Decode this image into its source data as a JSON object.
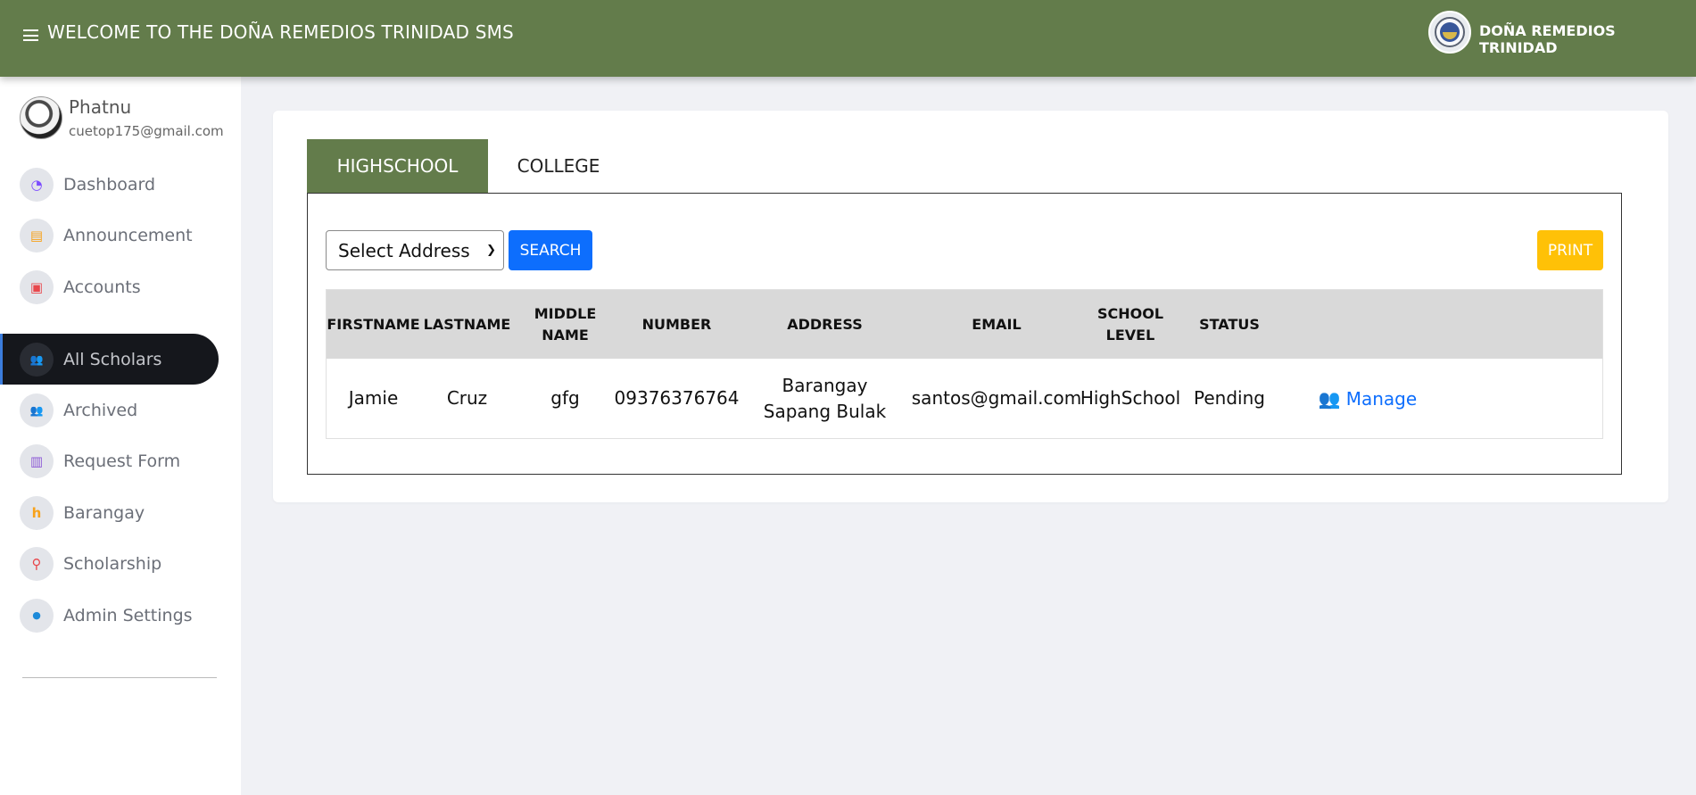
{
  "header": {
    "menu_icon": "hamburger-icon",
    "title": "WELCOME TO THE DOÑA REMEDIOS TRINIDAD SMS",
    "brand_name": "DOÑA REMEDIOS TRINIDAD",
    "brand_logo": "municipal-seal-logo",
    "bg_color": "#637c4b"
  },
  "profile": {
    "name": "Phatnu",
    "email": "cuetop175@gmail.com"
  },
  "sidebar": {
    "items": [
      {
        "label": "Dashboard",
        "icon": "gauge-icon",
        "glyph": "◔",
        "color": "#7c4dff"
      },
      {
        "label": "Announcement",
        "icon": "newspaper-icon",
        "glyph": "▤",
        "color": "#f7a21b"
      },
      {
        "label": "Accounts",
        "icon": "id-card-icon",
        "glyph": "▣",
        "color": "#e8474c"
      },
      {
        "label": "All Scholars",
        "icon": "users-icon",
        "glyph": "👥",
        "color": "#3b7ddd",
        "active": true
      },
      {
        "label": "Archived",
        "icon": "users-icon",
        "glyph": "👥",
        "color": "#28a745"
      },
      {
        "label": "Request Form",
        "icon": "address-book-icon",
        "glyph": "▥",
        "color": "#8e5bd6"
      },
      {
        "label": "Barangay",
        "icon": "house-icon",
        "glyph": "h",
        "color": "#f7a21b"
      },
      {
        "label": "Scholarship",
        "icon": "person-raised-icon",
        "glyph": "⚲",
        "color": "#e8474c"
      },
      {
        "label": "Admin Settings",
        "icon": "user-icon",
        "glyph": "●",
        "color": "#1c8ad9"
      }
    ]
  },
  "tabs": [
    {
      "label": "HIGHSCHOOL",
      "active": true
    },
    {
      "label": "COLLEGE",
      "active": false
    }
  ],
  "filters": {
    "address_select_value": "Select Address",
    "search_label": "SEARCH",
    "print_label": "PRINT"
  },
  "table": {
    "headers": [
      "FIRSTNAME",
      "LASTNAME",
      "MIDDLE NAME",
      "NUMBER",
      "ADDRESS",
      "EMAIL",
      "SCHOOL LEVEL",
      "STATUS",
      ""
    ],
    "rows": [
      {
        "firstname": "Jamie",
        "lastname": "Cruz",
        "middlename": "gfg",
        "number": "09376376764",
        "address": "Barangay Sapang Bulak",
        "email": "santos@gmail.com",
        "school_level": "HighSchool",
        "status": "Pending",
        "action": "Manage",
        "action_icon": "users-cog-icon"
      }
    ]
  },
  "colors": {
    "primary": "#0d6efd",
    "warning": "#ffc107",
    "brand_green": "#637c4b"
  }
}
